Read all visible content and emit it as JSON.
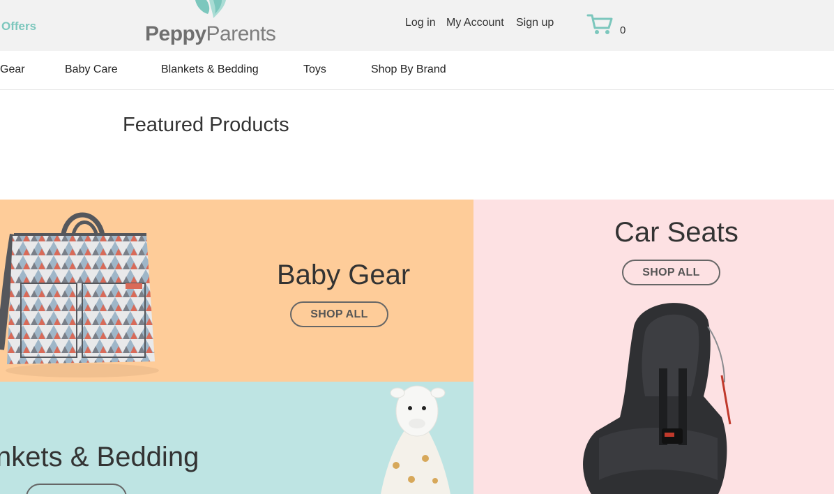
{
  "header": {
    "offers_label": "Offers",
    "logo": {
      "peppy": "Peppy",
      "parents": "Parents"
    },
    "account_links": [
      "Log in",
      "My Account",
      "Sign up"
    ],
    "cart_count": "0"
  },
  "nav": {
    "items": [
      "Gear",
      "Baby Care",
      "Blankets & Bedding",
      "Toys",
      "Shop By Brand"
    ]
  },
  "main": {
    "section_title": "Featured Products"
  },
  "panels": {
    "gear": {
      "title": "Baby Gear",
      "button": "SHOP ALL"
    },
    "seats": {
      "title": "Car Seats",
      "button": "SHOP ALL"
    },
    "blankets": {
      "title": "nkets & Bedding"
    }
  },
  "colors": {
    "accent": "#7cc7bd",
    "gear_bg": "#fecc99",
    "seats_bg": "#fde1e3",
    "blankets_bg": "#bee4e3",
    "header_bg": "#f2f2f2"
  },
  "icons": {
    "cart": "shopping-cart-icon",
    "logo_mark": "feet-logo-icon"
  }
}
